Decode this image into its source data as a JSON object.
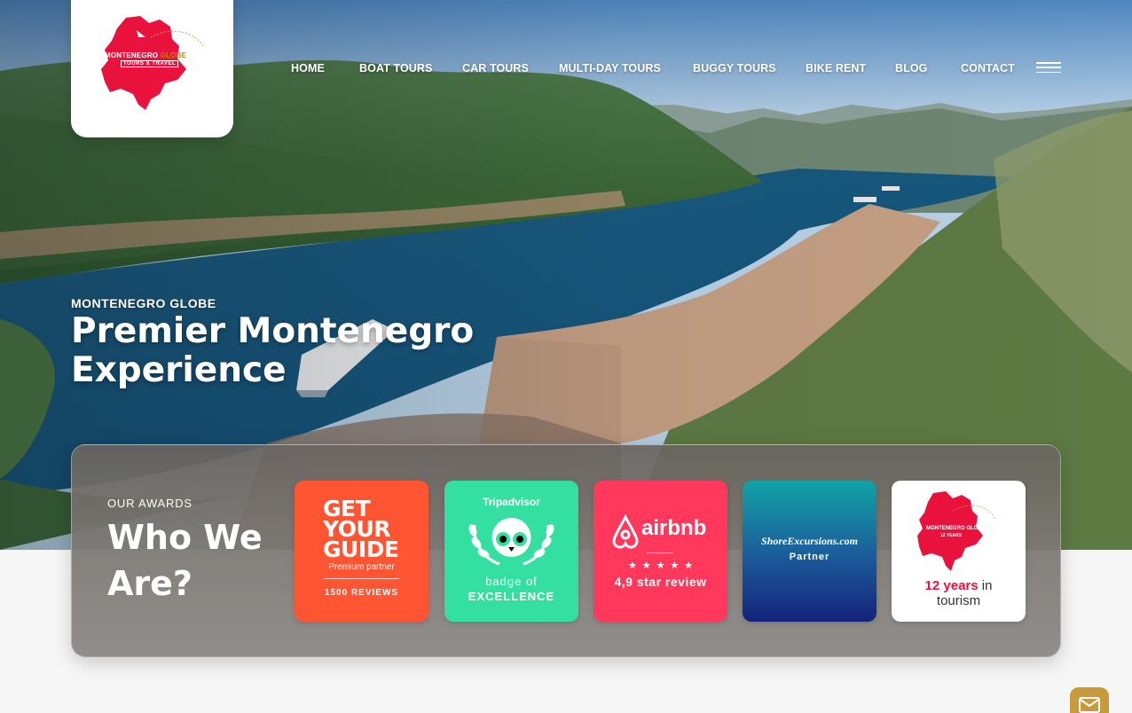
{
  "brand": {
    "logo_line1": "MONTENEGRO",
    "logo_line1_accent": "GLOBE",
    "logo_line2": "TOURS & TRAVEL",
    "logo_color": "#e8123c"
  },
  "nav": {
    "items": [
      "HOME",
      "BOAT TOURS",
      "CAR TOURS",
      "MULTI-DAY TOURS",
      "BUGGY TOURS",
      "BIKE RENT",
      "BLOG",
      "CONTACT"
    ]
  },
  "hero": {
    "kicker": "MONTENEGRO GLOBE",
    "headline": "Premier Montenegro Experience"
  },
  "awards": {
    "kicker": "OUR AWARDS",
    "title": "Who We Are?",
    "badges": {
      "gyg": {
        "logo": [
          "GET",
          "YOUR",
          "GUIDE"
        ],
        "subtitle": "Premium partner",
        "reviews": "1500 REVIEWS",
        "color": "#ff5533"
      },
      "tripadvisor": {
        "name": "Tripadvisor",
        "subtitle": "badge of",
        "highlight": "EXCELLENCE",
        "color": "#34e0a1"
      },
      "airbnb": {
        "name": "airbnb",
        "stars": "★★★★★",
        "review": "4,9 star review",
        "color": "#ff385c"
      },
      "shore": {
        "name": "ShoreExcursions.com",
        "subtitle": "Partner"
      },
      "globe": {
        "map_label": "MONTENEGRO GLOBE",
        "map_sub": "12 YEARS",
        "years": "12 years",
        "suffix": "in",
        "line2": "tourism"
      }
    }
  },
  "contact_fab": {
    "icon": "mail-icon",
    "color": "#c89a3c"
  }
}
